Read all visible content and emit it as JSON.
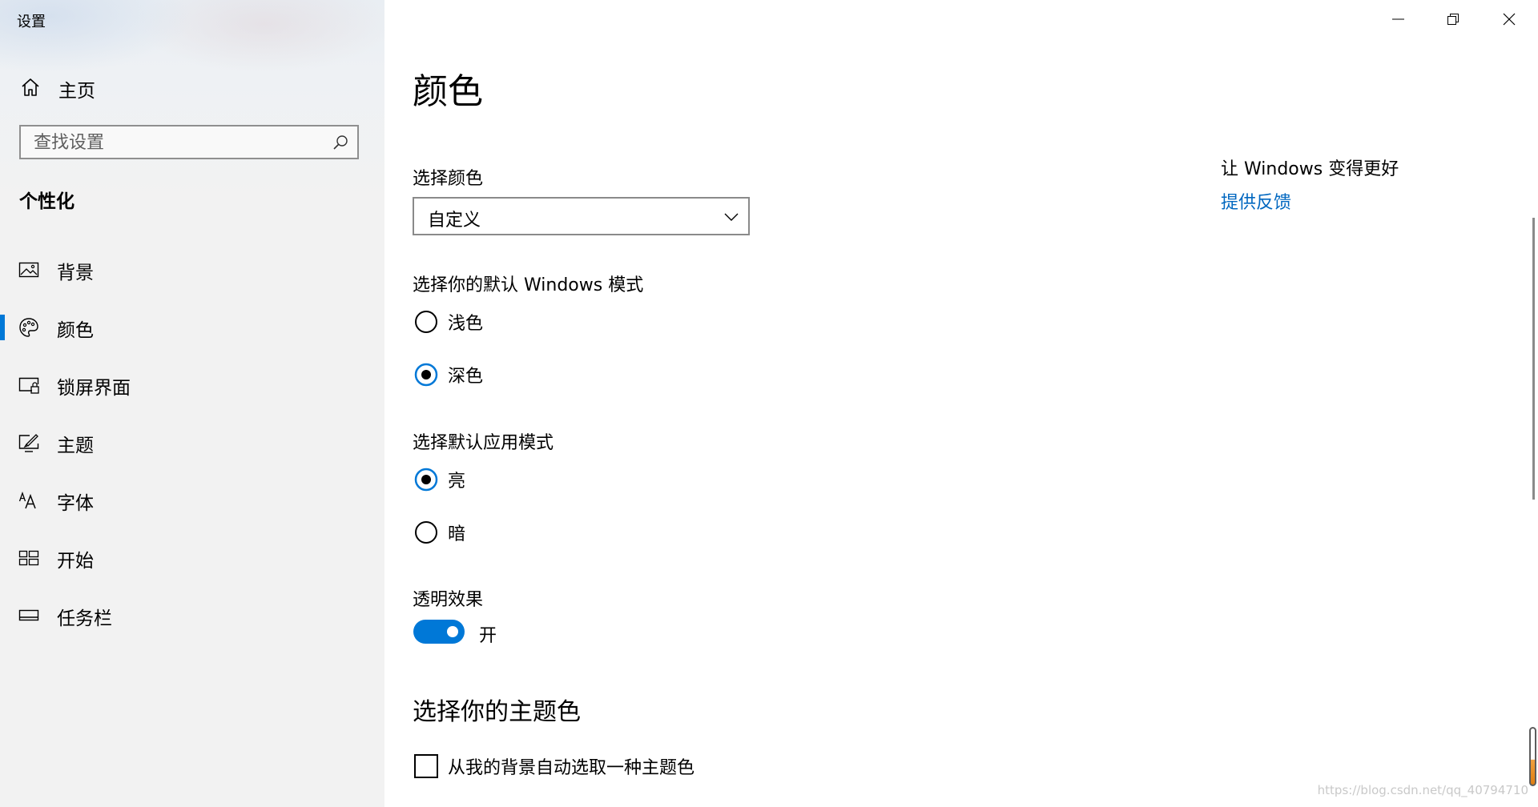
{
  "window": {
    "title": "设置"
  },
  "sidebar": {
    "home_label": "主页",
    "search_placeholder": "查找设置",
    "section_heading": "个性化",
    "items": [
      {
        "label": "背景",
        "icon": "picture-icon",
        "selected": false
      },
      {
        "label": "颜色",
        "icon": "palette-icon",
        "selected": true
      },
      {
        "label": "锁屏界面",
        "icon": "lock-screen-icon",
        "selected": false
      },
      {
        "label": "主题",
        "icon": "theme-brush-icon",
        "selected": false
      },
      {
        "label": "字体",
        "icon": "font-icon",
        "selected": false
      },
      {
        "label": "开始",
        "icon": "start-grid-icon",
        "selected": false
      },
      {
        "label": "任务栏",
        "icon": "taskbar-icon",
        "selected": false
      }
    ]
  },
  "main": {
    "page_title": "颜色",
    "choose_color_label": "选择颜色",
    "choose_color_value": "自定义",
    "windows_mode_label": "选择你的默认 Windows 模式",
    "windows_mode_options": [
      {
        "label": "浅色",
        "checked": false
      },
      {
        "label": "深色",
        "checked": true
      }
    ],
    "app_mode_label": "选择默认应用模式",
    "app_mode_options": [
      {
        "label": "亮",
        "checked": true
      },
      {
        "label": "暗",
        "checked": false
      }
    ],
    "transparency_label": "透明效果",
    "transparency_on": true,
    "transparency_state": "开",
    "accent_heading": "选择你的主题色",
    "auto_accent_label": "从我的背景自动选取一种主题色",
    "auto_accent_checked": false
  },
  "help": {
    "title": "让 Windows 变得更好",
    "feedback_link": "提供反馈"
  },
  "watermark": "https://blog.csdn.net/qq_40794710",
  "colors": {
    "accent": "#0078d7",
    "link": "#0067c0",
    "sidebar_bg": "#f2f2f2"
  }
}
